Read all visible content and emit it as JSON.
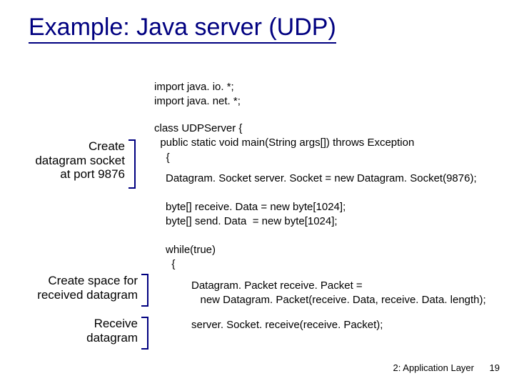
{
  "title": "Example: Java server (UDP)",
  "code": {
    "imports": "import java. io. *;\nimport java. net. *;",
    "class_head": "class UDPServer {\n  public static void main(String args[]) throws Exception\n    {",
    "datagram_socket": "Datagram. Socket server. Socket = new Datagram. Socket(9876);",
    "byte_arrays": "byte[] receive. Data = new byte[1024];\nbyte[] send. Data  = new byte[1024];",
    "while_head": "while(true)\n  {",
    "packet_decl": "Datagram. Packet receive. Packet =\n   new Datagram. Packet(receive. Data, receive. Data. length);",
    "receive_call": "server. Socket. receive(receive. Packet);"
  },
  "annotations": {
    "create_socket": "Create\ndatagram socket\nat port 9876",
    "create_space": "Create space for\nreceived datagram",
    "receive": "Receive\ndatagram"
  },
  "footer": {
    "chapter": "2: Application Layer",
    "page": "19"
  }
}
